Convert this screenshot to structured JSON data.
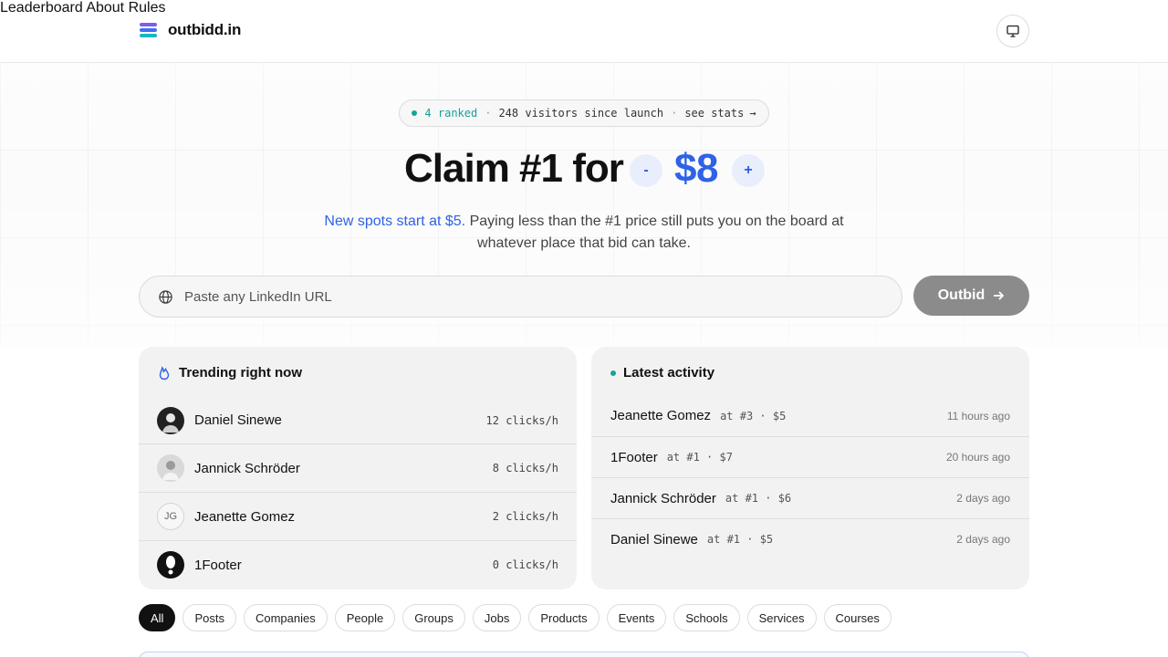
{
  "header": {
    "logo_text": "outbidd.in",
    "nav": [
      "Leaderboard",
      "About",
      "Rules"
    ],
    "theme_icon": "monitor-icon"
  },
  "hero": {
    "stats": {
      "ranked": "4 ranked",
      "sep": "·",
      "visitors": "248 visitors since launch",
      "see_stats": "see stats",
      "arrow": "→"
    },
    "headline": "Claim #1 for",
    "minus": "-",
    "price": "$8",
    "plus": "+",
    "sub_highlight": "New spots start at $5.",
    "sub_rest": " Paying less than the #1 price still puts you on the board at whatever place that bid can take.",
    "input_placeholder": "Paste any LinkedIn URL",
    "button": "Outbid"
  },
  "trending": {
    "title": "Trending right now",
    "icon": "flame-icon",
    "rows": [
      {
        "name": "Daniel Sinewe",
        "clicks": "12 clicks/h",
        "initials": ""
      },
      {
        "name": "Jannick Schröder",
        "clicks": "8 clicks/h",
        "initials": ""
      },
      {
        "name": "Jeanette Gomez",
        "clicks": "2 clicks/h",
        "initials": "JG"
      },
      {
        "name": "1Footer",
        "clicks": "0 clicks/h",
        "initials": ""
      }
    ]
  },
  "activity": {
    "title": "Latest activity",
    "rows": [
      {
        "name": "Jeanette Gomez",
        "detail": "at #3 · $5",
        "time": "11 hours ago"
      },
      {
        "name": "1Footer",
        "detail": "at #1 · $7",
        "time": "20 hours ago"
      },
      {
        "name": "Jannick Schröder",
        "detail": "at #1 · $6",
        "time": "2 days ago"
      },
      {
        "name": "Daniel Sinewe",
        "detail": "at #1 · $5",
        "time": "2 days ago"
      }
    ]
  },
  "filters": [
    "All",
    "Posts",
    "Companies",
    "People",
    "Groups",
    "Jobs",
    "Products",
    "Events",
    "Schools",
    "Services",
    "Courses"
  ],
  "colors": {
    "accent": "#2f62e6",
    "teal": "#13a39a",
    "button_disabled": "#8b8b8b"
  }
}
